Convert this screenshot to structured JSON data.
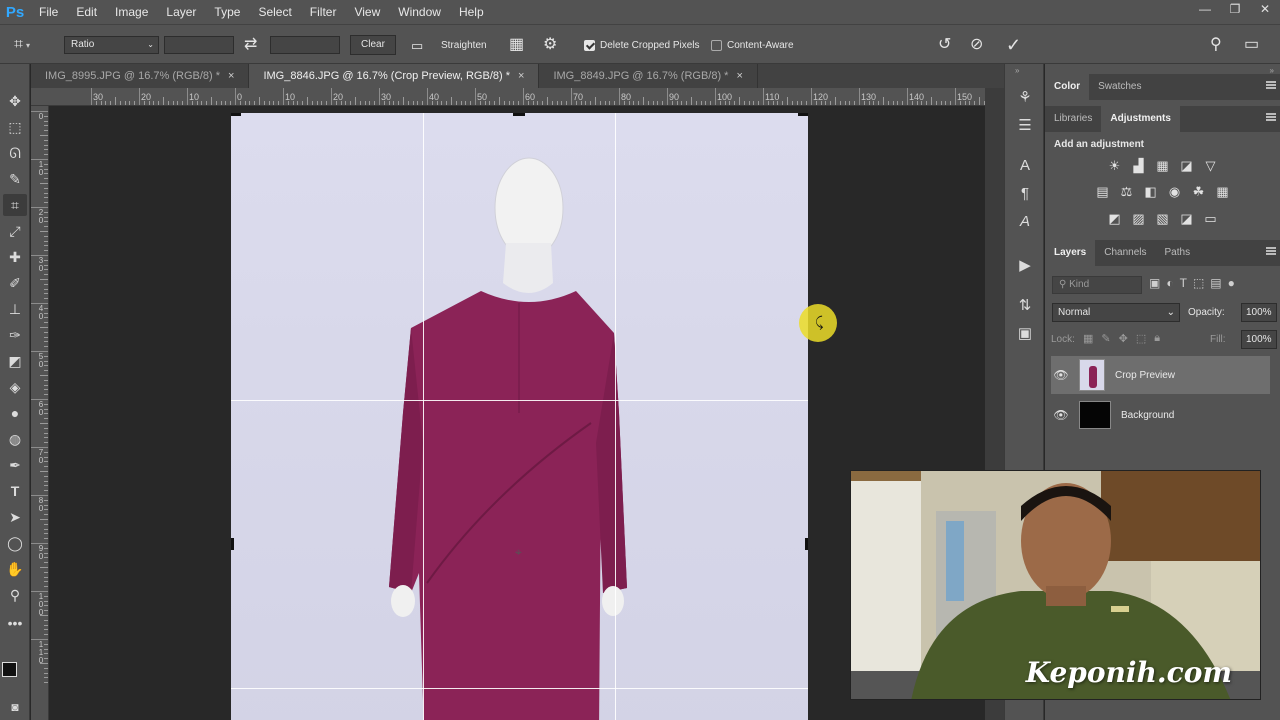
{
  "app": {
    "logo": "Ps"
  },
  "menu": [
    "File",
    "Edit",
    "Image",
    "Layer",
    "Type",
    "Select",
    "Filter",
    "View",
    "Window",
    "Help"
  ],
  "window_controls": {
    "minimize": "—",
    "restore": "❐",
    "close": "✕"
  },
  "options_bar": {
    "ratio_select": "Ratio",
    "clear_label": "Clear",
    "straighten_label": "Straighten",
    "delete_cropped_pixels": {
      "label": "Delete Cropped Pixels",
      "checked": true
    },
    "content_aware": {
      "label": "Content-Aware",
      "checked": false
    }
  },
  "tabs": [
    {
      "label": "IMG_8995.JPG @ 16.7% (RGB/8) *",
      "close": "×",
      "active": false
    },
    {
      "label": "IMG_8846.JPG @ 16.7% (Crop Preview, RGB/8) *",
      "close": "×",
      "active": true
    },
    {
      "label": "IMG_8849.JPG @ 16.7% (RGB/8) *",
      "close": "×",
      "active": false
    }
  ],
  "ruler_h_labels": [
    "30",
    "20",
    "10",
    "0",
    "10",
    "20",
    "30",
    "40",
    "50",
    "60",
    "70",
    "80",
    "90",
    "100",
    "110",
    "120",
    "130",
    "140",
    "150"
  ],
  "ruler_v_labels": [
    "0",
    "1 0",
    "2 0",
    "3 0",
    "4 0",
    "5 0",
    "6 0",
    "7 0",
    "8 0",
    "9 0",
    "1 0 0",
    "1 1 0"
  ],
  "panels": {
    "color_tabs": [
      "Color",
      "Swatches"
    ],
    "adjust_tabs": [
      "Libraries",
      "Adjustments"
    ],
    "add_adjustment": "Add an adjustment",
    "layers_tabs": [
      "Layers",
      "Channels",
      "Paths"
    ],
    "kind_placeholder": "Kind",
    "blend_mode": "Normal",
    "opacity_label": "Opacity:",
    "opacity_value": "100%",
    "lock_label": "Lock:",
    "fill_label": "Fill:",
    "fill_value": "100%",
    "layers": [
      {
        "name": "Crop Preview",
        "selected": true
      },
      {
        "name": "Background",
        "selected": false
      }
    ]
  },
  "watermark": "Keponih.com",
  "colors": {
    "accent": "#31a8ff",
    "dress": "#8b2357",
    "backdrop": "#d9d9ec"
  }
}
